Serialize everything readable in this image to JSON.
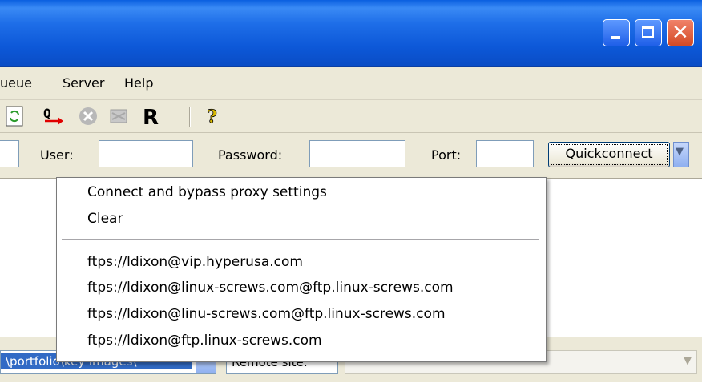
{
  "menubar": {
    "items": [
      "ueue",
      "Server",
      "Help"
    ]
  },
  "quickconnect": {
    "user_label": "User:",
    "user_value": "",
    "password_label": "Password:",
    "password_value": "",
    "port_label": "Port:",
    "port_value": "",
    "button_label": "Quickconnect"
  },
  "dropdown": {
    "items": [
      "Connect and bypass proxy settings",
      "Clear"
    ],
    "history": [
      "ftps://ldixon@vip.hyperusa.com",
      "ftps://ldixon@linux-screws.com@ftp.linux-screws.com",
      "ftps://ldixon@linu-screws.com@ftp.linux-screws.com",
      "ftps://ldixon@ftp.linux-screws.com"
    ]
  },
  "local_site": {
    "path": "\\portfolio\\key images\\"
  },
  "remote_site": {
    "label": "Remote site:"
  },
  "colors": {
    "titlebar": "#0a5fe0",
    "selection": "#316ac5",
    "window": "#ece9d8"
  }
}
